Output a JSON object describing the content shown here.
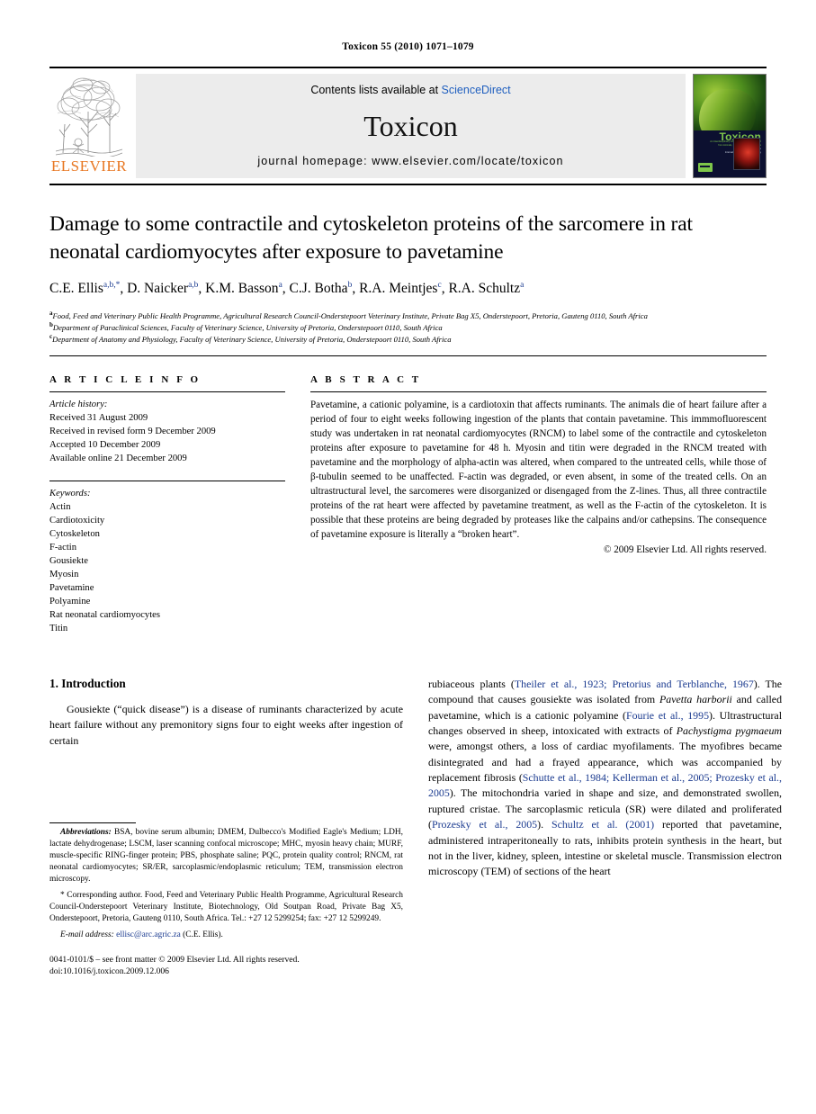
{
  "running_head": "Toxicon 55 (2010) 1071–1079",
  "masthead": {
    "publisher_name": "ELSEVIER",
    "contents_prefix": "Contents lists available at ",
    "sciencedirect": "ScienceDirect",
    "journal_title": "Toxicon",
    "homepage": "journal homepage: www.elsevier.com/locate/toxicon",
    "cover": {
      "title": "Toxicon",
      "subtitle_line1": "An Interdisciplinary Journal on the Toxins Derived",
      "subtitle_line2": "from Animals, Plants and Microorganisms",
      "subtitle_line3": "Official Journal of the",
      "subtitle_line4": "International Society on Toxinology"
    }
  },
  "article": {
    "title": "Damage to some contractile and cytoskeleton proteins of the sarcomere in rat neonatal cardiomyocytes after exposure to pavetamine",
    "authors": [
      {
        "name": "C.E. Ellis",
        "marks": "a,b,*"
      },
      {
        "name": "D. Naicker",
        "marks": "a,b"
      },
      {
        "name": "K.M. Basson",
        "marks": "a"
      },
      {
        "name": "C.J. Botha",
        "marks": "b"
      },
      {
        "name": "R.A. Meintjes",
        "marks": "c"
      },
      {
        "name": "R.A. Schultz",
        "marks": "a"
      }
    ],
    "affiliations": [
      {
        "mark": "a",
        "text": "Food, Feed and Veterinary Public Health Programme, Agricultural Research Council-Onderstepoort Veterinary Institute, Private Bag X5, Onderstepoort, Pretoria, Gauteng 0110, South Africa"
      },
      {
        "mark": "b",
        "text": "Department of Paraclinical Sciences, Faculty of Veterinary Science, University of Pretoria, Onderstepoort 0110, South Africa"
      },
      {
        "mark": "c",
        "text": "Department of Anatomy and Physiology, Faculty of Veterinary Science, University of Pretoria, Onderstepoort 0110, South Africa"
      }
    ]
  },
  "article_info": {
    "heading": "A R T I C L E   I N F O",
    "history_label": "Article history:",
    "history": [
      "Received 31 August 2009",
      "Received in revised form 9 December 2009",
      "Accepted 10 December 2009",
      "Available online 21 December 2009"
    ],
    "keywords_label": "Keywords:",
    "keywords": [
      "Actin",
      "Cardiotoxicity",
      "Cytoskeleton",
      "F-actin",
      "Gousiekte",
      "Myosin",
      "Pavetamine",
      "Polyamine",
      "Rat neonatal cardiomyocytes",
      "Titin"
    ]
  },
  "abstract": {
    "heading": "A B S T R A C T",
    "text": "Pavetamine, a cationic polyamine, is a cardiotoxin that affects ruminants. The animals die of heart failure after a period of four to eight weeks following ingestion of the plants that contain pavetamine. This immmofluorescent study was undertaken in rat neonatal cardiomyocytes (RNCM) to label some of the contractile and cytoskeleton proteins after exposure to pavetamine for 48 h. Myosin and titin were degraded in the RNCM treated with pavetamine and the morphology of alpha-actin was altered, when compared to the untreated cells, while those of β-tubulin seemed to be unaffected. F-actin was degraded, or even absent, in some of the treated cells. On an ultrastructural level, the sarcomeres were disorganized or disengaged from the Z-lines. Thus, all three contractile proteins of the rat heart were affected by pavetamine treatment, as well as the F-actin of the cytoskeleton. It is possible that these proteins are being degraded by proteases like the calpains and/or cathepsins. The consequence of pavetamine exposure is literally a “broken heart”.",
    "copyright": "© 2009 Elsevier Ltd. All rights reserved."
  },
  "introduction": {
    "heading": "1.  Introduction",
    "left_paragraph": "Gousiekte (“quick disease”) is a disease of ruminants characterized by acute heart failure without any premonitory signs four to eight weeks after ingestion of certain",
    "right_paragraph_parts": [
      {
        "t": "rubiaceous plants (",
        "k": "plain"
      },
      {
        "t": "Theiler et al., 1923; Pretorius and Terblanche, 1967",
        "k": "cite"
      },
      {
        "t": "). The compound that causes gousiekte was isolated from ",
        "k": "plain"
      },
      {
        "t": "Pavetta harborii",
        "k": "ital"
      },
      {
        "t": " and called pavetamine, which is a cationic polyamine (",
        "k": "plain"
      },
      {
        "t": "Fourie et al., 1995",
        "k": "cite"
      },
      {
        "t": "). Ultrastructural changes observed in sheep, intoxicated with extracts of ",
        "k": "plain"
      },
      {
        "t": "Pachystigma pygmaeum",
        "k": "ital"
      },
      {
        "t": " were, amongst others, a loss of cardiac myofilaments. The myofibres became disintegrated and had a frayed appearance, which was accompanied by replacement fibrosis (",
        "k": "plain"
      },
      {
        "t": "Schutte et al., 1984; Kellerman et al., 2005; Prozesky et al., 2005",
        "k": "cite"
      },
      {
        "t": "). The mitochondria varied in shape and size, and demonstrated swollen, ruptured cristae. The sarcoplasmic reticula (SR) were dilated and proliferated (",
        "k": "plain"
      },
      {
        "t": "Prozesky et al., 2005",
        "k": "cite"
      },
      {
        "t": "). ",
        "k": "plain"
      },
      {
        "t": "Schultz et al. (2001)",
        "k": "cite"
      },
      {
        "t": " reported that pavetamine, administered intraperitoneally to rats, inhibits protein synthesis in the heart, but not in the liver, kidney, spleen, intestine or skeletal muscle. Transmission electron microscopy (TEM) of sections of the heart",
        "k": "plain"
      }
    ]
  },
  "footnotes": {
    "abbreviations_label": "Abbreviations:",
    "abbreviations_text": "BSA, bovine serum albumin; DMEM, Dulbecco's Modified Eagle's Medium; LDH, lactate dehydrogenase; LSCM, laser scanning confocal microscope; MHC, myosin heavy chain; MURF, muscle-specific RING-finger protein; PBS, phosphate saline; PQC, protein quality control; RNCM, rat neonatal cardiomyocytes; SR/ER, sarcoplasmic/endoplasmic reticulum; TEM, transmission electron microscopy.",
    "corresponding_text": "* Corresponding author. Food, Feed and Veterinary Public Health Programme, Agricultural Research Council-Onderstepoort Veterinary Institute, Biotechnology, Old Soutpan Road, Private Bag X5, Onderstepoort, Pretoria, Gauteng 0110, South Africa. Tel.: +27 12 5299254; fax: +27 12 5299249.",
    "email_label": "E-mail address:",
    "email": "ellisc@arc.agric.za",
    "email_owner": "(C.E. Ellis).",
    "issn_line": "0041-0101/$ – see front matter © 2009 Elsevier Ltd. All rights reserved.",
    "doi_line": "doi:10.1016/j.toxicon.2009.12.006"
  },
  "colors": {
    "elsevier_orange": "#E87722",
    "link_blue": "#1a3a8f",
    "sciencedirect_blue": "#1f5fbf",
    "banner_gray": "#ececec"
  }
}
